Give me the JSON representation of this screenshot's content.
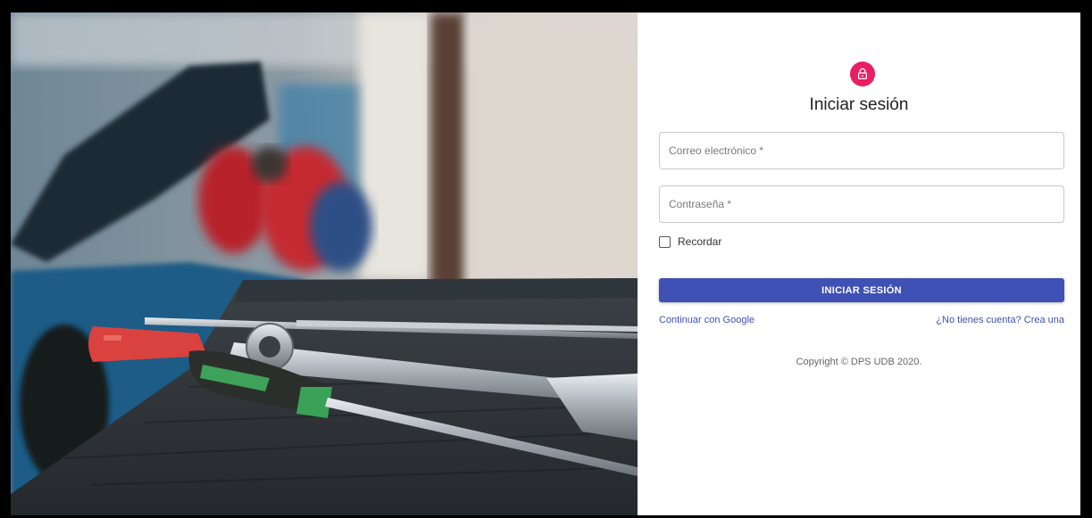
{
  "colors": {
    "accent": "#e91e63",
    "primary": "#3f51b5",
    "link": "#3f51b5"
  },
  "hero": {
    "image_subject": "blurred mechanics working under an open car hood with wrenches and screwdrivers on a workbench in the foreground"
  },
  "login": {
    "icon": "lock-icon",
    "title": "Iniciar sesión",
    "email": {
      "placeholder": "Correo electrónico *",
      "value": ""
    },
    "password": {
      "placeholder": "Contraseña *",
      "value": ""
    },
    "remember": {
      "label": "Recordar",
      "checked": false
    },
    "submit_label": "INICIAR SESIÓN",
    "google_link": "Continuar con Google",
    "signup_link": "¿No tienes cuenta? Crea una",
    "copyright": "Copyright © DPS UDB 2020."
  }
}
